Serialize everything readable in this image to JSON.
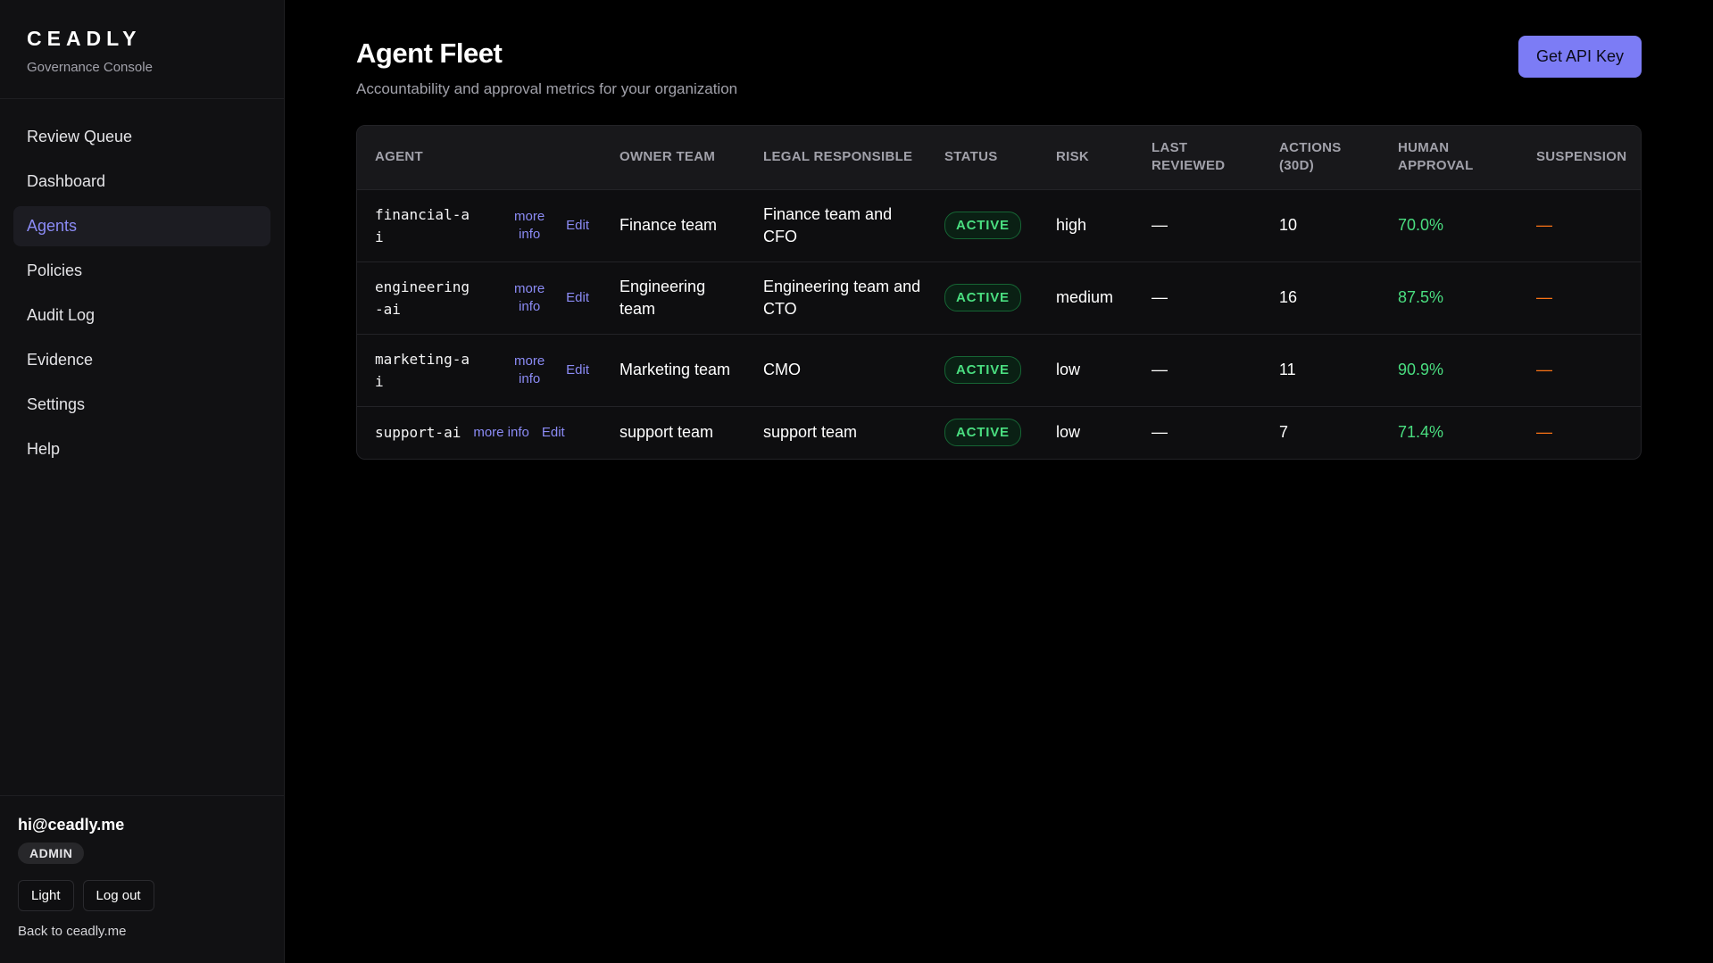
{
  "brand": {
    "name": "CEADLY",
    "subtitle": "Governance Console"
  },
  "nav": [
    {
      "label": "Review Queue",
      "active": false
    },
    {
      "label": "Dashboard",
      "active": false
    },
    {
      "label": "Agents",
      "active": true
    },
    {
      "label": "Policies",
      "active": false
    },
    {
      "label": "Audit Log",
      "active": false
    },
    {
      "label": "Evidence",
      "active": false
    },
    {
      "label": "Settings",
      "active": false
    },
    {
      "label": "Help",
      "active": false
    }
  ],
  "user": {
    "email": "hi@ceadly.me",
    "role": "ADMIN",
    "theme_button": "Light",
    "logout_button": "Log out",
    "back_link": "Back to ceadly.me"
  },
  "page": {
    "title": "Agent Fleet",
    "subtitle": "Accountability and approval metrics for your organization",
    "api_button": "Get API Key"
  },
  "table": {
    "headers": [
      "AGENT",
      "OWNER TEAM",
      "LEGAL RESPONSIBLE",
      "STATUS",
      "RISK",
      "LAST REVIEWED",
      "ACTIONS (30D)",
      "HUMAN APPROVAL",
      "SUSPENSION"
    ],
    "link_more": "more info",
    "link_edit": "Edit",
    "rows": [
      {
        "agent": "financial-ai",
        "owner": "Finance team",
        "legal": "Finance team and CFO",
        "status": "ACTIVE",
        "risk": "high",
        "last_reviewed": "—",
        "actions": "10",
        "approval": "70.0%",
        "suspension": "—"
      },
      {
        "agent": "engineering-ai",
        "owner": "Engineering team",
        "legal": "Engineering team and CTO",
        "status": "ACTIVE",
        "risk": "medium",
        "last_reviewed": "—",
        "actions": "16",
        "approval": "87.5%",
        "suspension": "—"
      },
      {
        "agent": "marketing-ai",
        "owner": "Marketing team",
        "legal": "CMO",
        "status": "ACTIVE",
        "risk": "low",
        "last_reviewed": "—",
        "actions": "11",
        "approval": "90.9%",
        "suspension": "—"
      },
      {
        "agent": "support-ai",
        "owner": "support team",
        "legal": "support team",
        "status": "ACTIVE",
        "risk": "low",
        "last_reviewed": "—",
        "actions": "7",
        "approval": "71.4%",
        "suspension": "—"
      }
    ]
  },
  "colors": {
    "accent": "#7c7cf5",
    "status_active": "#4ade80",
    "suspension": "#f97316"
  }
}
